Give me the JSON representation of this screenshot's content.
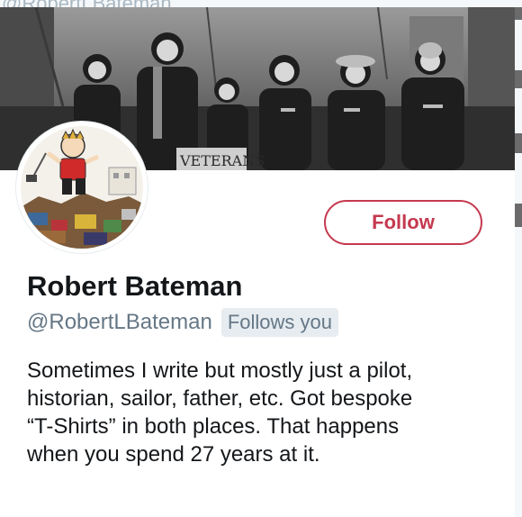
{
  "background_page": {
    "cutoff_text": "@RobertLBateman"
  },
  "banner": {
    "sign_text": "VETERANS"
  },
  "profile": {
    "name": "Robert Bateman",
    "handle": "@RobertLBateman",
    "follows_you_label": "Follows you",
    "bio_lines": [
      "Sometimes I write but mostly just a pilot,",
      "historian, sailor, father, etc. Got bespoke",
      "“T-Shirts” in both places. That happens",
      "when you spend 27 years at it."
    ]
  },
  "actions": {
    "follow_label": "Follow"
  },
  "colors": {
    "accent": "#c5394f",
    "text_primary": "#14171a",
    "text_secondary": "#657786",
    "badge_bg": "#e6ecf0"
  }
}
